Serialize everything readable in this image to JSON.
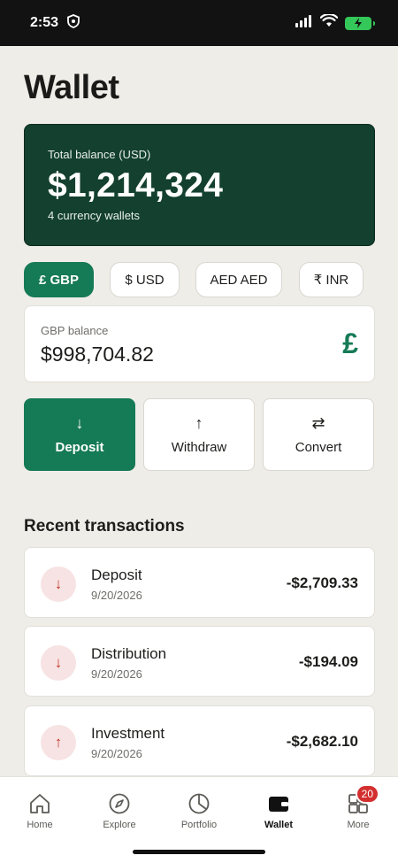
{
  "status_bar": {
    "time": "2:53",
    "icons": [
      "shield-icon",
      "signal-icon",
      "wifi-icon",
      "battery-charging-icon"
    ]
  },
  "page": {
    "title": "Wallet"
  },
  "balance_card": {
    "label": "Total balance (USD)",
    "amount": "$1,214,324",
    "subtitle": "4 currency wallets",
    "background_color": "#13402f"
  },
  "currency_tabs": [
    {
      "label": "£ GBP",
      "active": true
    },
    {
      "label": "$ USD",
      "active": false
    },
    {
      "label": "AED AED",
      "active": false
    },
    {
      "label": "₹ INR",
      "active": false
    }
  ],
  "selected_wallet": {
    "label": "GBP balance",
    "amount": "$998,704.82",
    "symbol": "£"
  },
  "actions": [
    {
      "label": "Deposit",
      "icon": "arrow-down-icon",
      "glyph": "↓",
      "primary": true
    },
    {
      "label": "Withdraw",
      "icon": "arrow-up-icon",
      "glyph": "↑",
      "primary": false
    },
    {
      "label": "Convert",
      "icon": "swap-icon",
      "glyph": "⇄",
      "primary": false
    }
  ],
  "recent_transactions": {
    "title": "Recent transactions",
    "items": [
      {
        "title": "Deposit",
        "date": "9/20/2026",
        "amount": "-$2,709.33",
        "icon": "arrow-down-icon",
        "glyph": "↓"
      },
      {
        "title": "Distribution",
        "date": "9/20/2026",
        "amount": "-$194.09",
        "icon": "arrow-down-icon",
        "glyph": "↓"
      },
      {
        "title": "Investment",
        "date": "9/20/2026",
        "amount": "-$2,682.10",
        "icon": "arrow-up-icon",
        "glyph": "↑"
      }
    ]
  },
  "bottom_nav": {
    "items": [
      {
        "label": "Home",
        "icon": "home-icon",
        "active": false
      },
      {
        "label": "Explore",
        "icon": "compass-icon",
        "active": false
      },
      {
        "label": "Portfolio",
        "icon": "pie-chart-icon",
        "active": false
      },
      {
        "label": "Wallet",
        "icon": "wallet-icon",
        "active": true
      },
      {
        "label": "More",
        "icon": "grid-icon",
        "active": false,
        "badge": "20"
      }
    ]
  },
  "colors": {
    "accent": "#157a56",
    "negative_icon": "#c0392b",
    "badge": "#d32f2f"
  }
}
